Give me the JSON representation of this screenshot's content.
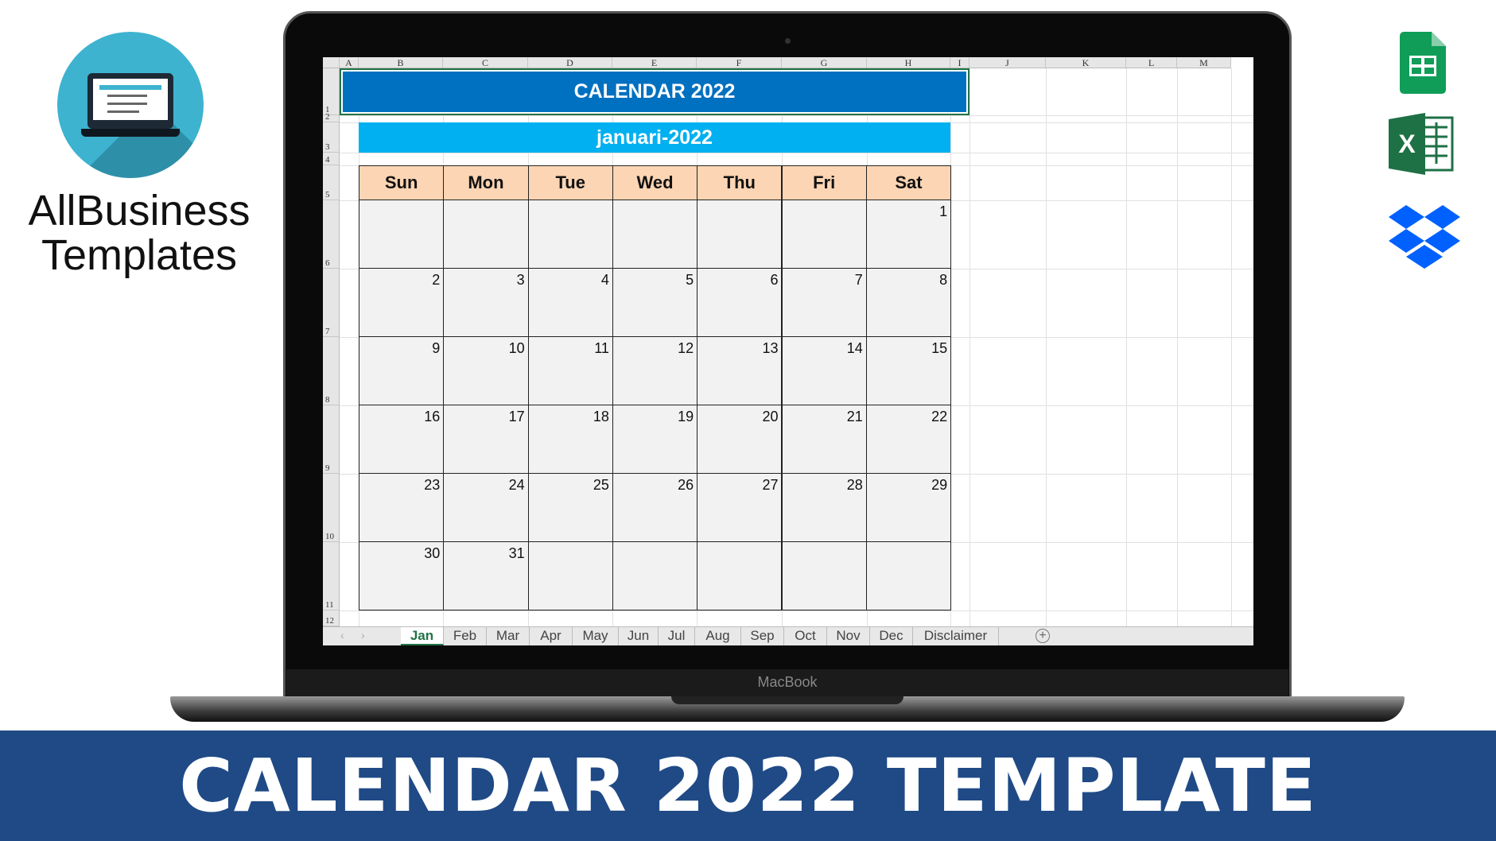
{
  "brand": {
    "line1": "AllBusiness",
    "line2": "Templates"
  },
  "laptop_label": "MacBook",
  "banner": "CALENDAR 2022 TEMPLATE",
  "sheet": {
    "columns": [
      "A",
      "B",
      "C",
      "D",
      "E",
      "F",
      "G",
      "H",
      "I",
      "J",
      "K",
      "L",
      "M"
    ],
    "rows": [
      "1",
      "2",
      "3",
      "4",
      "5",
      "6",
      "7",
      "8",
      "9",
      "10",
      "11",
      "12"
    ],
    "title": "CALENDAR 2022",
    "month": "januari-2022",
    "weekdays": [
      "Sun",
      "Mon",
      "Tue",
      "Wed",
      "Thu",
      "Fri",
      "Sat"
    ],
    "weeks": [
      [
        "",
        "",
        "",
        "",
        "",
        "",
        "1"
      ],
      [
        "2",
        "3",
        "4",
        "5",
        "6",
        "7",
        "8"
      ],
      [
        "9",
        "10",
        "11",
        "12",
        "13",
        "14",
        "15"
      ],
      [
        "16",
        "17",
        "18",
        "19",
        "20",
        "21",
        "22"
      ],
      [
        "23",
        "24",
        "25",
        "26",
        "27",
        "28",
        "29"
      ],
      [
        "30",
        "31",
        "",
        "",
        "",
        "",
        ""
      ]
    ],
    "tabs": [
      "Jan",
      "Feb",
      "Mar",
      "Apr",
      "May",
      "Jun",
      "Jul",
      "Aug",
      "Sep",
      "Oct",
      "Nov",
      "Dec",
      "Disclaimer"
    ],
    "active_tab": "Jan"
  },
  "icons": [
    "google-sheets-icon",
    "excel-icon",
    "dropbox-icon"
  ],
  "colors": {
    "title": "#0070c0",
    "month": "#00b0f0",
    "header": "#fcd5b4",
    "banner": "#1f4a86"
  }
}
